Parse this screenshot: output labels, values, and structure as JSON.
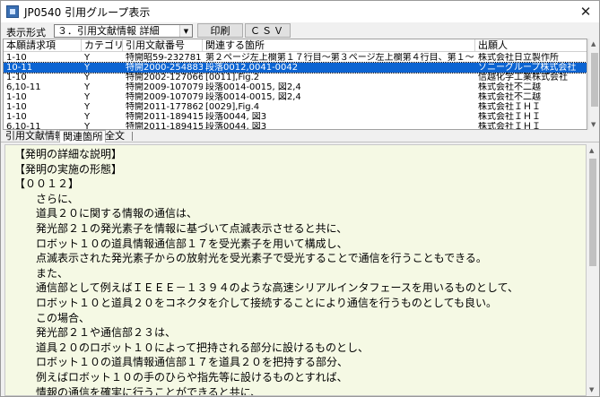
{
  "window": {
    "title": "JP0540 引用グループ表示",
    "close_glyph": "✕"
  },
  "toolbar": {
    "display_label": "表示形式",
    "display_value": "３．引用文献情報 詳細",
    "print_label": "印刷",
    "csv_label": "ＣＳＶ"
  },
  "table": {
    "columns": [
      "本願請求項",
      "カテゴリ",
      "引用文献番号",
      "関連する箇所",
      "出願人"
    ],
    "rows": [
      [
        "1-10",
        "Y",
        "特開昭59-232781",
        "第２ページ左上欄第１７行目～第３ページ左上欄第４行目、第１～５図",
        "株式会社日立製作所"
      ],
      [
        "10-11",
        "Y",
        "特開2000-254883",
        "段落0012,0041-0042",
        "ソニーグループ株式会社"
      ],
      [
        "1-10",
        "Y",
        "特開2002-127066",
        "[0011],Fig.2",
        "信越化学工業株式会社"
      ],
      [
        "6,10-11",
        "Y",
        "特開2009-107079",
        "段落0014-0015, 図2,4",
        "株式会社不二越"
      ],
      [
        "1-10",
        "Y",
        "特開2009-107079",
        "段落0014-0015, 図2,4",
        "株式会社不二越"
      ],
      [
        "1-10",
        "Y",
        "特開2011-177862",
        "[0029],Fig.4",
        "株式会社ＩＨＩ"
      ],
      [
        "1-10",
        "Y",
        "特開2011-189415",
        "段落0044, 図3",
        "株式会社ＩＨＩ"
      ],
      [
        "6,10-11",
        "Y",
        "特開2011-189415",
        "段落0044, 図3",
        "株式会社ＩＨＩ"
      ]
    ],
    "selected_index": 1
  },
  "tabs": [
    "引用文献情報",
    "関連箇所",
    "全文"
  ],
  "active_tab": 1,
  "content": {
    "lines": [
      "【発明の詳細な説明】",
      "【発明の実施の形態】",
      "【００１２】",
      "　　さらに、",
      "　　道具２０に関する情報の通信は、",
      "　　発光部２１の発光素子を情報に基づいて点滅表示させると共に、",
      "　　ロボット１０の道具情報通信部１７を受光素子を用いて構成し、",
      "　　点滅表示された発光素子からの放射光を受光素子で受光することで通信を行うこともできる。",
      "　　また、",
      "　　通信部として例えばＩＥＥＥ－１３９４のような高速シリアルインタフェースを用いるものとして、",
      "　　ロボット１０と道具２０をコネクタを介して接続することにより通信を行うものとしても良い。",
      "　　この場合、",
      "　　発光部２１や通信部２３は、",
      "　　道具２０のロボット１０によって把持される部分に設けるものとし、",
      "　　ロボット１０の道具情報通信部１７を道具２０を把持する部分、",
      "　　例えばロボット１０の手のひらや指先等に設けるものとすれば、",
      "　　情報の通信を確実に行うことができると共に、"
    ]
  }
}
